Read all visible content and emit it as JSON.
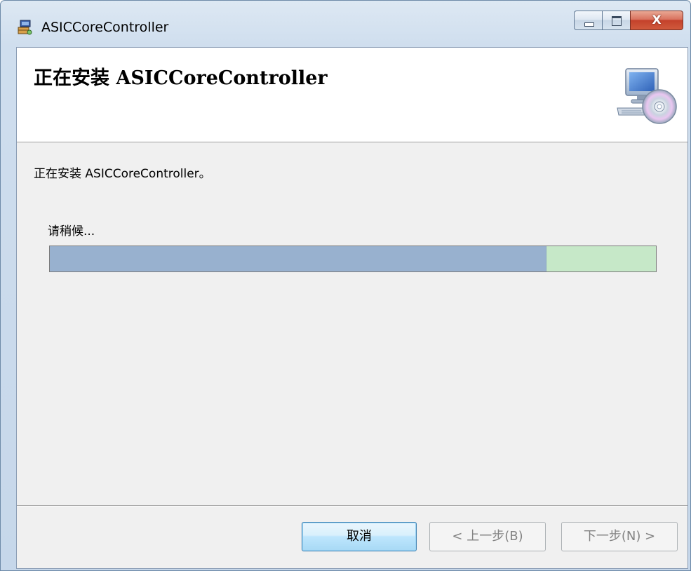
{
  "window": {
    "title": "ASICCoreController",
    "caption_buttons": {
      "minimize_icon": "minimize-icon",
      "maximize_icon": "maximize-icon",
      "close_glyph": "X"
    }
  },
  "banner": {
    "title": "正在安装 ASICCoreController",
    "icon": "computer-cd-icon"
  },
  "content": {
    "status_text": "正在安装 ASICCoreController。",
    "wait_label": "请稍候...",
    "progress_fraction": 0.82
  },
  "buttons": {
    "cancel": "取消",
    "back": "< 上一步(B)",
    "next": "下一步(N) >"
  },
  "colors": {
    "progress_fill": "#98b1cf",
    "progress_track": "#c6e8c8",
    "close_button": "#c4412b"
  }
}
